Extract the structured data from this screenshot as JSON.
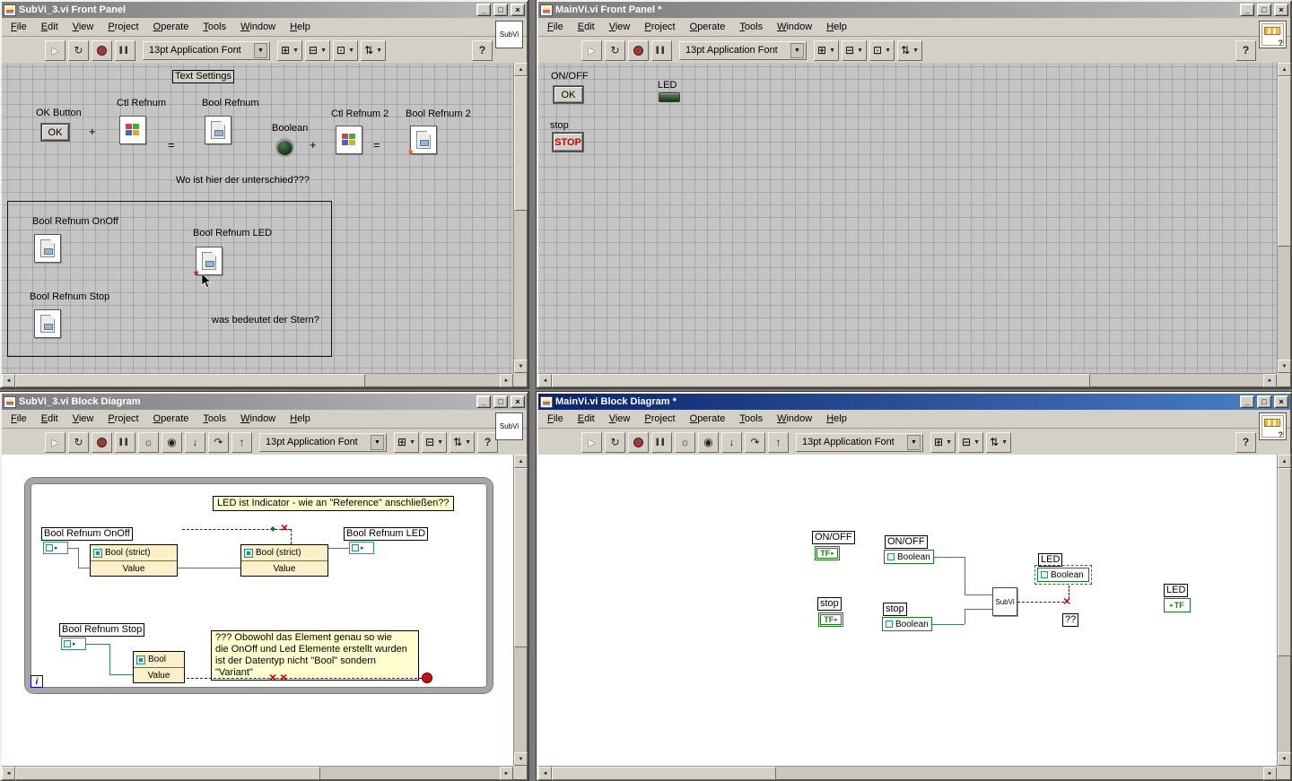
{
  "chrome": {
    "menu": [
      "File",
      "Edit",
      "View",
      "Project",
      "Operate",
      "Tools",
      "Window",
      "Help"
    ],
    "font_selector": "13pt Application Font",
    "minimize": "_",
    "maximize": "□",
    "close": "×"
  },
  "icons": {
    "run": "►",
    "run_continuous": "↻",
    "pause": "▌▌",
    "highlight_execution": "☼",
    "retain_wire_values": "◉",
    "step_into": "↓",
    "step_over": "↷",
    "step_out": "↑",
    "align": "⊞",
    "distribute": "⊟",
    "resize": "⊡",
    "reorder": "⇅",
    "dropdown": "▼",
    "help": "?",
    "up": "▲",
    "down": "▼",
    "left": "◄",
    "right": "►",
    "term_arrow": "▸",
    "diamond": "◆",
    "broken_x": "×",
    "star": "*"
  },
  "colors": {
    "wire_teal": "#3c7b7b",
    "broken_red": "#d40000",
    "comment_bg": "#ffffd0",
    "active_title": "#0a246a"
  },
  "windows": {
    "subvi_fp": {
      "title": "SubVi_3.vi Front Panel",
      "corner": "SubVi",
      "text_settings": "Text Settings",
      "ok_label": "OK Button",
      "ok_text": "OK",
      "plus": "+",
      "equals": "=",
      "ctl_refnum": "Ctl Refnum",
      "bool_refnum": "Bool Refnum",
      "boolean": "Boolean",
      "ctl_refnum2": "Ctl Refnum 2",
      "bool_refnum2": "Bool Refnum 2",
      "question": "Wo ist hier der unterschied???",
      "onoff": "Bool Refnum OnOff",
      "led": "Bool Refnum LED",
      "stop": "Bool Refnum Stop",
      "star_question": "was bedeutet der Stern?"
    },
    "main_fp": {
      "title": "MainVi.vi Front Panel *",
      "onoff": "ON/OFF",
      "ok": "OK",
      "led": "LED",
      "stop": "stop",
      "stop_btn": "STOP"
    },
    "subvi_bd": {
      "title": "SubVi_3.vi Block Diagram",
      "corner": "SubVi",
      "comment_led": "LED ist Indicator - wie an \"Reference\" anschließen??",
      "onoff": "Bool Refnum OnOff",
      "led": "Bool Refnum LED",
      "stop": "Bool Refnum Stop",
      "prop_strict": "Bool (strict)",
      "prop_bool": "Bool",
      "value": "Value",
      "comment_variant": "??? Obowohl das Element genau so wie\ndie OnOff und Led Elemente erstellt wurden\nist der Datentyp nicht \"Bool\" sondern \"Variant\"",
      "iteration": "i"
    },
    "main_bd": {
      "title": "MainVi.vi Block Diagram *",
      "onoff": "ON/OFF",
      "tf": "TF",
      "boolean": "Boolean",
      "stop": "stop",
      "subvi": "SubVi",
      "led": "LED",
      "qq": "??"
    }
  }
}
